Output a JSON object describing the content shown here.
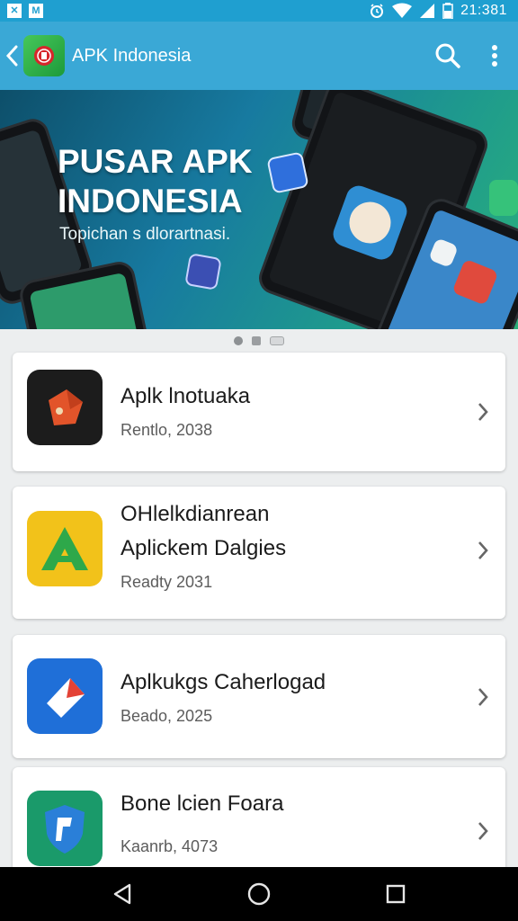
{
  "status_bar": {
    "left_icons": [
      "app-notification-icon",
      "gmail-icon"
    ],
    "right_icons": [
      "alarm-icon",
      "wifi-icon",
      "signal-icon",
      "battery-icon"
    ],
    "time": "21:381"
  },
  "app_bar": {
    "back_icon": "back-arrow-icon",
    "title": "APK Indonesia",
    "actions": [
      "search-icon",
      "more-vert-icon"
    ]
  },
  "banner": {
    "title_line1": "PUSAR APK",
    "title_line2": "INDONESIA",
    "subtitle": "Topichan s dlorartnasi."
  },
  "pager": {
    "count": 3,
    "active_index": 0
  },
  "apps": [
    {
      "title_lines": [
        "Aplk lnotuaka"
      ],
      "subtitle": "Rentlo, 2038",
      "icon": "red-box-app-icon",
      "icon_bg": "#1c1c1c"
    },
    {
      "title_lines": [
        "OHlelkdianrean",
        "Aplickem Dalgies"
      ],
      "subtitle": "Readty 2031",
      "icon": "letter-a-app-icon",
      "icon_bg": "#f2c21a"
    },
    {
      "title_lines": [
        "Aplkukgs Caherlogad"
      ],
      "subtitle": "Beado, 2025",
      "icon": "paper-plane-app-icon",
      "icon_bg": "#1f6fd8"
    },
    {
      "title_lines": [
        "Bone lcien Foara"
      ],
      "subtitle": "Kaanrb, 4073",
      "icon": "shield-app-icon",
      "icon_bg": "#1a9a6a"
    }
  ],
  "nav_bar": {
    "buttons": [
      "back-triangle-icon",
      "home-circle-icon",
      "recents-square-icon"
    ]
  },
  "colors": {
    "primary": "#3aa8d6",
    "status": "#1f9fd0",
    "background": "#eceeef"
  }
}
